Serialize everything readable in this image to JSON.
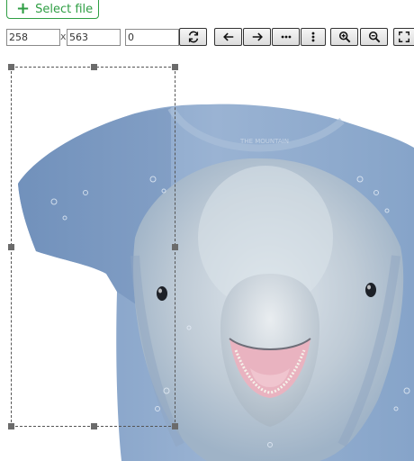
{
  "toolbar": {
    "select_file_label": "Select file",
    "width_value": "258",
    "height_value": "563",
    "times_symbol": "x",
    "rotation_value": "0"
  },
  "icons": {
    "plus": "plus-icon",
    "rotate": "rotate-icon",
    "prev": "arrow-left-icon",
    "next": "arrow-right-icon",
    "more_h": "more-horizontal-icon",
    "more_v": "more-vertical-icon",
    "zoom_in": "zoom-in-icon",
    "zoom_out": "zoom-out-icon",
    "fullscreen": "fullscreen-icon"
  },
  "image": {
    "subject": "dolphin face t-shirt",
    "shirt_print_text": "THE MOUNTAIN"
  },
  "colors": {
    "accent_green": "#2f9e44",
    "shirt_blue": "#7f9fc6",
    "shirt_light": "#b9cde2"
  }
}
